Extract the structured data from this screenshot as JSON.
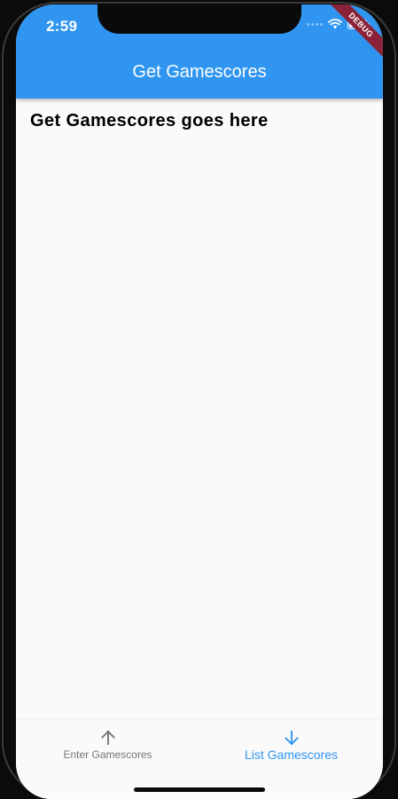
{
  "status_bar": {
    "time": "2:59",
    "battery_level": 0.85,
    "icons": [
      "signal-dots-icon",
      "wifi-icon",
      "battery-icon"
    ]
  },
  "debug_banner": {
    "label": "DEBUG"
  },
  "app_bar": {
    "title": "Get Gamescores"
  },
  "main": {
    "heading": "Get Gamescores goes here"
  },
  "bottom_nav": {
    "items": [
      {
        "label": "Enter Gamescores",
        "icon": "arrow-up-icon",
        "active": false,
        "color": "#757575"
      },
      {
        "label": "List Gamescores",
        "icon": "arrow-down-icon",
        "active": true,
        "color": "#2f95f0"
      }
    ]
  },
  "colors": {
    "primary": "#2f95f0",
    "background": "#fafafa",
    "inactive": "#757575",
    "debug_banner": "#8a2338"
  }
}
